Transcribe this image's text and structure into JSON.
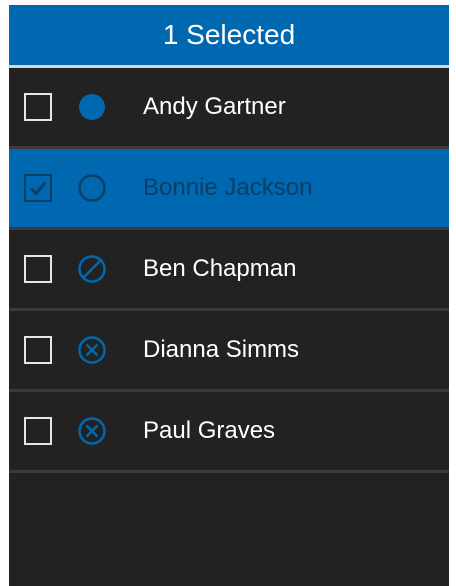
{
  "header": {
    "title": "1 Selected"
  },
  "colors": {
    "accent": "#0067b1",
    "background": "#222222",
    "selected_text": "#0a3f66",
    "text": "#ffffff"
  },
  "contacts": [
    {
      "name": "Andy Gartner",
      "status_icon": "filled-circle-icon",
      "selected": false
    },
    {
      "name": "Bonnie Jackson",
      "status_icon": "empty-circle-icon",
      "selected": true
    },
    {
      "name": "Ben Chapman",
      "status_icon": "do-not-disturb-icon",
      "selected": false
    },
    {
      "name": "Dianna Simms",
      "status_icon": "offline-x-circle-icon",
      "selected": false
    },
    {
      "name": "Paul Graves",
      "status_icon": "offline-x-circle-icon",
      "selected": false
    }
  ]
}
